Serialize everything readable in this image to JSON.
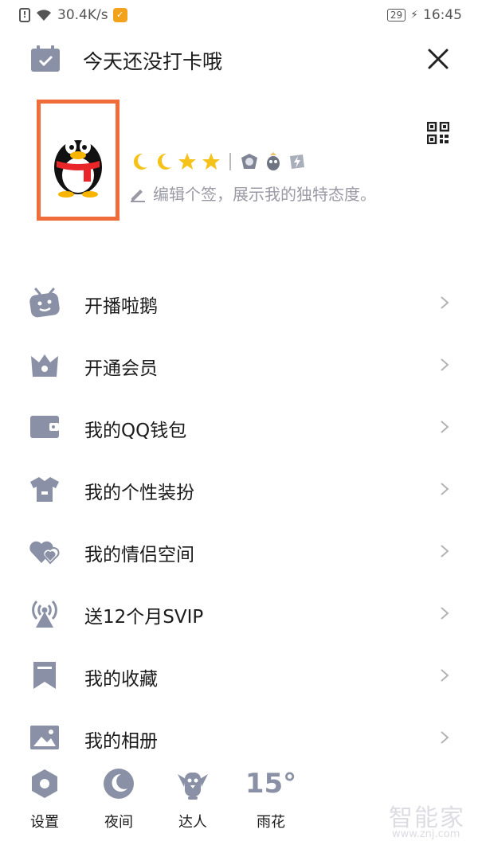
{
  "status_bar": {
    "network_speed": "30.4K/s",
    "battery": "29",
    "time": "16:45"
  },
  "header": {
    "checkin_text": "今天还没打卡哦"
  },
  "profile": {
    "signature_placeholder": "编辑个签，展示我的独特态度。",
    "level_icons": [
      "moon",
      "moon",
      "star",
      "star",
      "level-badge",
      "level-badge",
      "level-badge"
    ]
  },
  "menu": [
    {
      "label": "开播啦鹅",
      "icon": "tv-icon"
    },
    {
      "label": "开通会员",
      "icon": "crown-icon"
    },
    {
      "label": "我的QQ钱包",
      "icon": "wallet-icon"
    },
    {
      "label": "我的个性装扮",
      "icon": "shirt-icon"
    },
    {
      "label": "我的情侣空间",
      "icon": "hearts-icon"
    },
    {
      "label": "送12个月SVIP",
      "icon": "broadcast-icon"
    },
    {
      "label": "我的收藏",
      "icon": "bookmark-icon"
    },
    {
      "label": "我的相册",
      "icon": "photo-icon"
    }
  ],
  "bottom_bar": {
    "settings": "设置",
    "night": "夜间",
    "expert": "达人",
    "temperature": "15°",
    "weather": "雨花"
  },
  "watermark": {
    "main": "智能家",
    "sub": "www.znj.com"
  },
  "colors": {
    "icon_gray": "#8a91a6",
    "avatar_border": "#f16c3b",
    "text": "#1b1b1b",
    "placeholder": "#9a9aa6"
  }
}
